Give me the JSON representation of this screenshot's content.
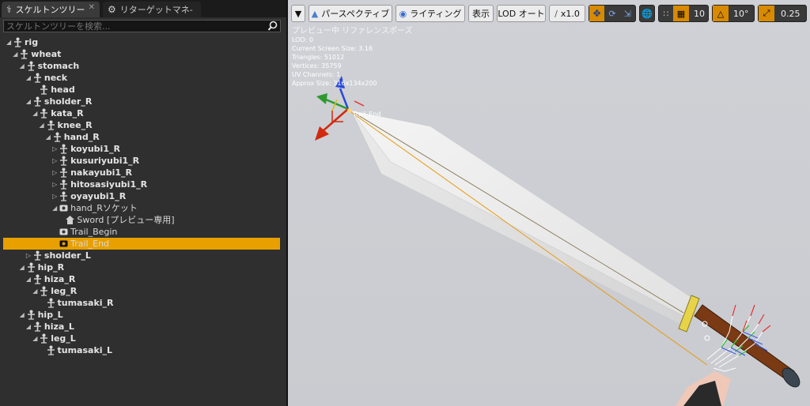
{
  "tabs": [
    {
      "label": "スケルトンツリー",
      "icon": "skeleton-icon"
    },
    {
      "label": "リターゲットマネ-",
      "icon": "retarget-icon"
    }
  ],
  "search": {
    "placeholder": "スケルトンツリーを検索..."
  },
  "tree": [
    {
      "label": "rig",
      "depth": 0,
      "expander": "open",
      "icon": "bone-icon"
    },
    {
      "label": "wheat",
      "depth": 1,
      "expander": "open",
      "icon": "bone-icon"
    },
    {
      "label": "stomach",
      "depth": 2,
      "expander": "open",
      "icon": "bone-icon"
    },
    {
      "label": "neck",
      "depth": 3,
      "expander": "open",
      "icon": "bone-icon"
    },
    {
      "label": "head",
      "depth": 4,
      "expander": "none",
      "icon": "bone-icon"
    },
    {
      "label": "sholder_R",
      "depth": 3,
      "expander": "open",
      "icon": "bone-icon"
    },
    {
      "label": "kata_R",
      "depth": 4,
      "expander": "open",
      "icon": "bone-icon"
    },
    {
      "label": "knee_R",
      "depth": 5,
      "expander": "open",
      "icon": "bone-icon"
    },
    {
      "label": "hand_R",
      "depth": 6,
      "expander": "open",
      "icon": "bone-icon"
    },
    {
      "label": "koyubi1_R",
      "depth": 7,
      "expander": "closed",
      "icon": "bone-icon"
    },
    {
      "label": "kusuriyubi1_R",
      "depth": 7,
      "expander": "closed",
      "icon": "bone-icon"
    },
    {
      "label": "nakayubi1_R",
      "depth": 7,
      "expander": "closed",
      "icon": "bone-icon"
    },
    {
      "label": "hitosasiyubi1_R",
      "depth": 7,
      "expander": "closed",
      "icon": "bone-icon"
    },
    {
      "label": "oyayubi1_R",
      "depth": 7,
      "expander": "closed",
      "icon": "bone-icon"
    },
    {
      "label": "hand_Rソケット",
      "depth": 7,
      "expander": "open",
      "icon": "socket-icon"
    },
    {
      "label": "Sword [プレビュー専用]",
      "depth": 8,
      "expander": "none",
      "icon": "mesh-icon"
    },
    {
      "label": "Trail_Begin",
      "depth": 7,
      "expander": "none",
      "icon": "socket-icon"
    },
    {
      "label": "Trail_End",
      "depth": 7,
      "expander": "none",
      "icon": "socket-icon",
      "selected": true
    },
    {
      "label": "sholder_L",
      "depth": 3,
      "expander": "closed",
      "icon": "bone-icon"
    },
    {
      "label": "hip_R",
      "depth": 2,
      "expander": "open",
      "icon": "bone-icon"
    },
    {
      "label": "hiza_R",
      "depth": 3,
      "expander": "open",
      "icon": "bone-icon"
    },
    {
      "label": "leg_R",
      "depth": 4,
      "expander": "open",
      "icon": "bone-icon"
    },
    {
      "label": "tumasaki_R",
      "depth": 5,
      "expander": "none",
      "icon": "bone-icon"
    },
    {
      "label": "hip_L",
      "depth": 2,
      "expander": "open",
      "icon": "bone-icon"
    },
    {
      "label": "hiza_L",
      "depth": 3,
      "expander": "open",
      "icon": "bone-icon"
    },
    {
      "label": "leg_L",
      "depth": 4,
      "expander": "open",
      "icon": "bone-icon"
    },
    {
      "label": "tumasaki_L",
      "depth": 5,
      "expander": "none",
      "icon": "bone-icon"
    }
  ],
  "toolbar": {
    "perspective": "パースペクティブ",
    "lighting": "ライティング",
    "show": "表示",
    "lod": "LOD オート",
    "speed": "x1.0",
    "grid_size": "10",
    "rotation_snap": "10°",
    "scale_snap": "0.25"
  },
  "viewport_info": {
    "mode": "プレビュー中 リファレンスポーズ",
    "lines": [
      "LOD: 0",
      "Current Screen Size: 3.16",
      "Triangles: 51012",
      "Vertices: 35759",
      "UV Channels: 1",
      "Approx Size: 316x134x200"
    ],
    "socket_label": "Trail_End"
  },
  "colors": {
    "selection": "#e8a000",
    "panel_bg": "#2f2f2f",
    "viewport_bg": "#cfd1d6",
    "accent_toggle": "#d88a00"
  }
}
